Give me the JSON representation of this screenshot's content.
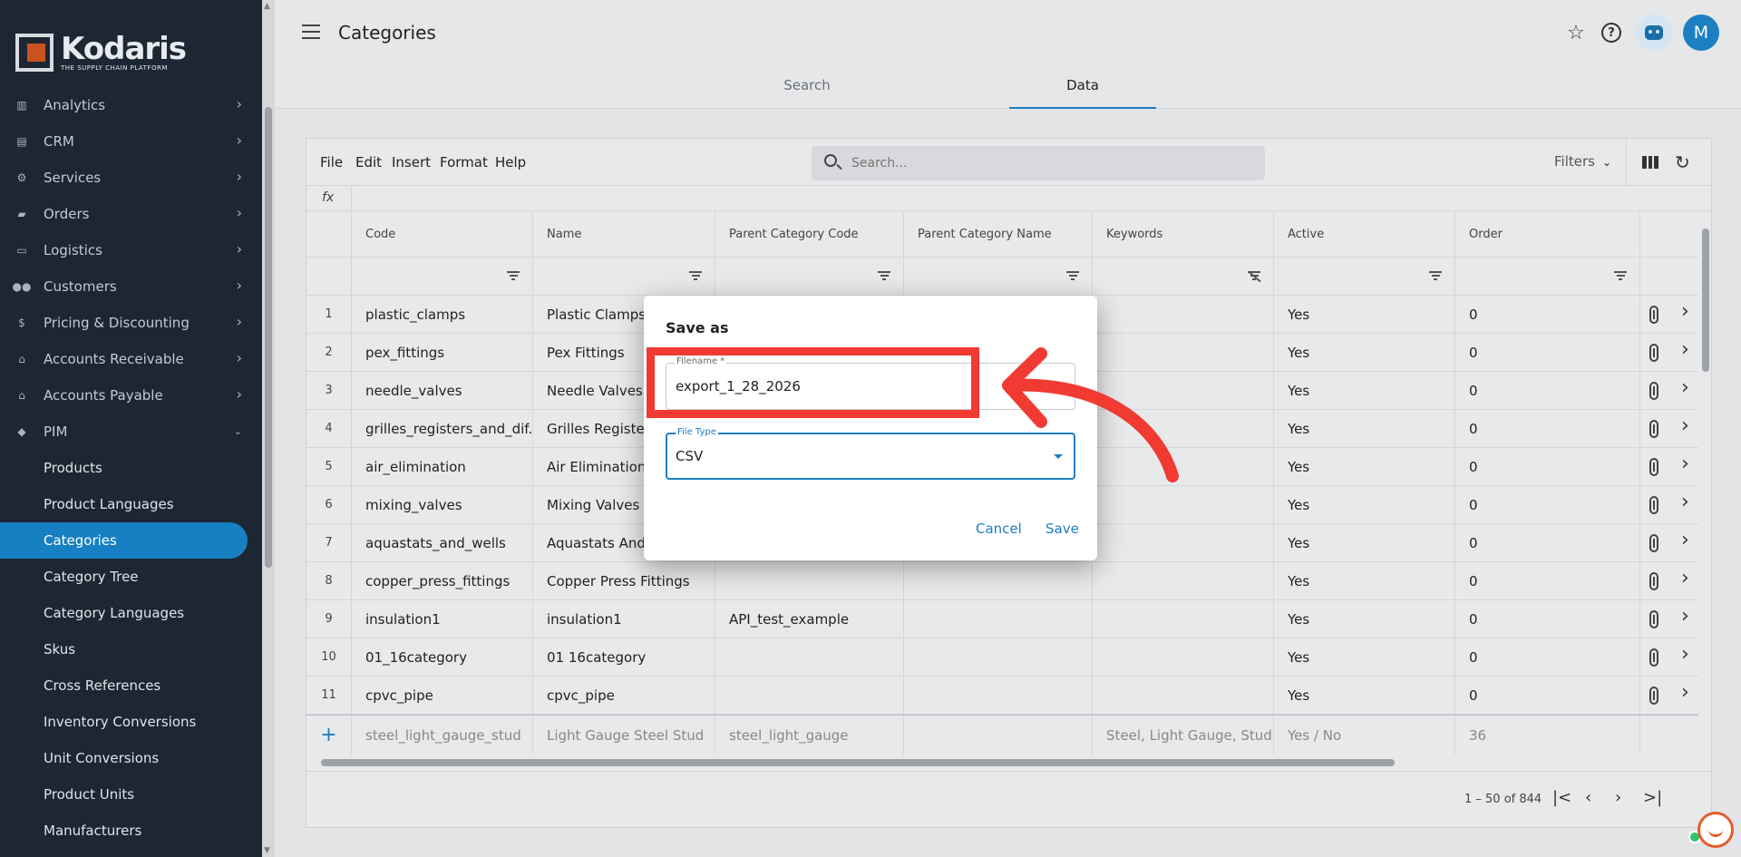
{
  "app": {
    "brand": "Kodaris",
    "tagline": "THE SUPPLY CHAIN PLATFORM"
  },
  "sidebar": {
    "items": [
      {
        "label": "Analytics",
        "icon": "chart-icon"
      },
      {
        "label": "CRM",
        "icon": "id-card-icon"
      },
      {
        "label": "Services",
        "icon": "gears-icon"
      },
      {
        "label": "Orders",
        "icon": "truck-icon"
      },
      {
        "label": "Logistics",
        "icon": "delivery-van-icon"
      },
      {
        "label": "Customers",
        "icon": "people-icon"
      },
      {
        "label": "Pricing & Discounting",
        "icon": "dollar-icon"
      },
      {
        "label": "Accounts Receivable",
        "icon": "bank-icon"
      },
      {
        "label": "Accounts Payable",
        "icon": "bank-icon"
      },
      {
        "label": "PIM",
        "icon": "tag-icon"
      }
    ],
    "pim_children": [
      "Products",
      "Product Languages",
      "Categories",
      "Category Tree",
      "Category Languages",
      "Skus",
      "Cross References",
      "Inventory Conversions",
      "Unit Conversions",
      "Product Units",
      "Manufacturers"
    ],
    "active": "Categories"
  },
  "header": {
    "title": "Categories",
    "avatar_initial": "M",
    "tabs": [
      {
        "label": "Search"
      },
      {
        "label": "Data",
        "active": true
      }
    ]
  },
  "toolbar": {
    "menus": [
      "File",
      "Edit",
      "Insert",
      "Format",
      "Help"
    ],
    "search_placeholder": "Search...",
    "filters_label": "Filters"
  },
  "fx_label": "fx",
  "grid": {
    "columns": [
      "Code",
      "Name",
      "Parent Category Code",
      "Parent Category Name",
      "Keywords",
      "Active",
      "Order"
    ],
    "rows": [
      [
        "1",
        "plastic_clamps",
        "Plastic Clamps",
        "",
        "",
        "",
        "Yes",
        "0"
      ],
      [
        "2",
        "pex_fittings",
        "Pex Fittings",
        "",
        "",
        "",
        "Yes",
        "0"
      ],
      [
        "3",
        "needle_valves",
        "Needle Valves",
        "",
        "",
        "",
        "Yes",
        "0"
      ],
      [
        "4",
        "grilles_registers_and_dif...",
        "Grilles Registers",
        "",
        "",
        "",
        "Yes",
        "0"
      ],
      [
        "5",
        "air_elimination",
        "Air Elimination",
        "",
        "",
        "",
        "Yes",
        "0"
      ],
      [
        "6",
        "mixing_valves",
        "Mixing Valves",
        "",
        "",
        "",
        "Yes",
        "0"
      ],
      [
        "7",
        "aquastats_and_wells",
        "Aquastats And V",
        "",
        "",
        "",
        "Yes",
        "0"
      ],
      [
        "8",
        "copper_press_fittings",
        "Copper Press Fittings",
        "",
        "",
        "",
        "Yes",
        "0"
      ],
      [
        "9",
        "insulation1",
        "insulation1",
        "API_test_example",
        "",
        "",
        "Yes",
        "0"
      ],
      [
        "10",
        "01_16category",
        "01 16category",
        "",
        "",
        "",
        "Yes",
        "0"
      ],
      [
        "11",
        "cpvc_pipe",
        "cpvc_pipe",
        "",
        "",
        "",
        "Yes",
        "0"
      ]
    ],
    "new_row": [
      "steel_light_gauge_stud",
      "Light Gauge Steel Stud",
      "steel_light_gauge",
      "",
      "Steel, Light Gauge, Stud",
      "Yes / No",
      "36"
    ],
    "pager_range": "1 – 50 of 844"
  },
  "dialog": {
    "title": "Save as",
    "filename_label": "Filename *",
    "filename_value": "export_1_28_2026",
    "filetype_label": "File Type",
    "filetype_value": "CSV",
    "cancel_label": "Cancel",
    "save_label": "Save"
  },
  "colors": {
    "accent": "#1c7fc1",
    "sidebar_bg": "#1c2733",
    "annotation": "#f03a32",
    "logo_orange": "#c8531f"
  }
}
